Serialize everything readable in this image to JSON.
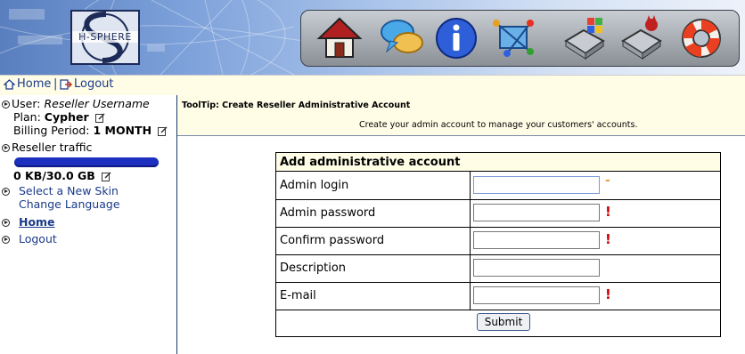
{
  "header": {
    "logo_text": "H-SPHERE",
    "toolbar_icons": [
      "home-icon",
      "chat-icon",
      "info-icon",
      "network-icon",
      "windows-server-icon",
      "unix-server-icon",
      "help-lifebuoy-icon"
    ]
  },
  "nav": {
    "home": "Home",
    "separator": "|",
    "logout": "Logout"
  },
  "sidebar": {
    "user_label": "User:",
    "user_value": "Reseller Username",
    "plan_label": "Plan:",
    "plan_value": "Cypher",
    "billing_label": "Billing Period:",
    "billing_value": "1 MONTH",
    "traffic_label": "Reseller traffic",
    "traffic_fraction": 0.0,
    "traffic_value": "0 KB/30.0 GB",
    "select_skin": "Select a New Skin",
    "change_language": "Change Language",
    "home": "Home",
    "logout": "Logout"
  },
  "tooltip": {
    "title": "ToolTip: Create Reseller Administrative Account",
    "text": "Create your admin account to manage your customers' accounts."
  },
  "form": {
    "heading": "Add administrative account",
    "fields": [
      {
        "label": "Admin login",
        "value": "",
        "mark": "-"
      },
      {
        "label": "Admin password",
        "value": "",
        "mark": "!"
      },
      {
        "label": "Confirm password",
        "value": "",
        "mark": "!"
      },
      {
        "label": "Description",
        "value": "",
        "mark": ""
      },
      {
        "label": "E-mail",
        "value": "",
        "mark": "!"
      }
    ],
    "submit": "Submit"
  },
  "colors": {
    "link": "#1a3a8a",
    "tooltip_bg": "#fffde6",
    "traffic_bar": "#1c2fbf",
    "required_mark": "#d00000"
  }
}
